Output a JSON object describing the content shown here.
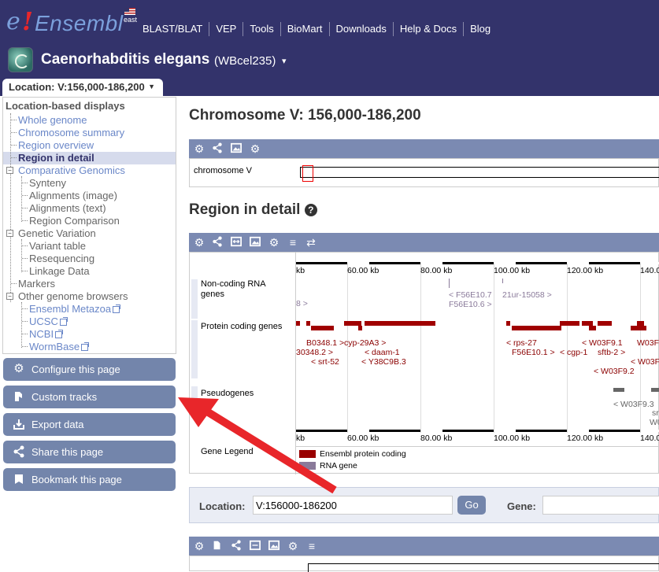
{
  "header": {
    "logo_e": "e",
    "logo_bang": "!",
    "logo_name": "Ensembl",
    "site_sub": "east",
    "nav": [
      "BLAST/BLAT",
      "VEP",
      "Tools",
      "BioMart",
      "Downloads",
      "Help & Docs",
      "Blog"
    ],
    "species": "Caenorhabditis elegans",
    "assembly": "(WBcel235)",
    "species_caret": "▾",
    "location_tab": "Location: V:156,000-186,200",
    "location_tab_caret": "▼"
  },
  "sidebar": {
    "heading": "Location-based displays",
    "items": [
      {
        "label": "Whole genome"
      },
      {
        "label": "Chromosome summary"
      },
      {
        "label": "Region overview"
      },
      {
        "label": "Region in detail"
      },
      {
        "label": "Comparative Genomics"
      },
      {
        "label": "Synteny"
      },
      {
        "label": "Alignments (image)"
      },
      {
        "label": "Alignments (text)"
      },
      {
        "label": "Region Comparison"
      },
      {
        "label": "Genetic Variation"
      },
      {
        "label": "Variant table"
      },
      {
        "label": "Resequencing"
      },
      {
        "label": "Linkage Data"
      },
      {
        "label": "Markers"
      },
      {
        "label": "Other genome browsers"
      },
      {
        "label": "Ensembl Metazoa"
      },
      {
        "label": "UCSC"
      },
      {
        "label": "NCBI"
      },
      {
        "label": "WormBase"
      }
    ],
    "buttons": [
      {
        "label": "Configure this page",
        "icon": "gear-icon"
      },
      {
        "label": "Custom tracks",
        "icon": "custom-tracks-icon"
      },
      {
        "label": "Export data",
        "icon": "export-icon"
      },
      {
        "label": "Share this page",
        "icon": "share-icon"
      },
      {
        "label": "Bookmark this page",
        "icon": "bookmark-icon"
      }
    ]
  },
  "main": {
    "chrom_title": "Chromosome V: 156,000-186,200",
    "chrom_label": "chromosome V",
    "region_title": "Region in detail",
    "help_glyph": "?",
    "scale_labels": [
      "kb",
      "60.00 kb",
      "80.00 kb",
      "100.00 kb",
      "120.00 kb",
      "140.0"
    ],
    "tracks": {
      "noncoding": "Non-coding RNA genes",
      "protein": "Protein coding genes",
      "pseudo": "Pseudogenes",
      "legend": "Gene Legend"
    },
    "gene_labels": {
      "nc1": "8 >",
      "nc2": "< F56E10.7",
      "nc3": "F56E10.6 >",
      "nc4": "21ur-15058 >",
      "p1": "B0348.1 >",
      "p2": "cyp-29A3 >",
      "p3": "30348.2 >",
      "p4": "< daam-1",
      "p5": "< srt-52",
      "p6": "< Y38C9B.3",
      "p7": "< rps-27",
      "p8": "F56E10.1 >",
      "p9": "< cgp-1",
      "p10": "< W03F9.1",
      "p11": "sftb-2 >",
      "p12": "W03F9",
      "p13": "< W03F9.2",
      "p14": "< W03F9",
      "ps1": "< W03F9.3",
      "ps2": "sr",
      "ps3": "W0"
    },
    "legend_items": [
      {
        "label": "Ensembl protein coding",
        "color": "#990000"
      },
      {
        "label": "RNA gene",
        "color": "#8a7a9a"
      }
    ],
    "location_bar": {
      "location_label": "Location:",
      "location_value": "V:156000-186200",
      "go_label": "Go",
      "gene_label": "Gene:"
    }
  },
  "colors": {
    "masthead": "#33336b",
    "toolbar": "#7b8ab2",
    "button": "#7385ab",
    "arrow": "#e8262a"
  }
}
